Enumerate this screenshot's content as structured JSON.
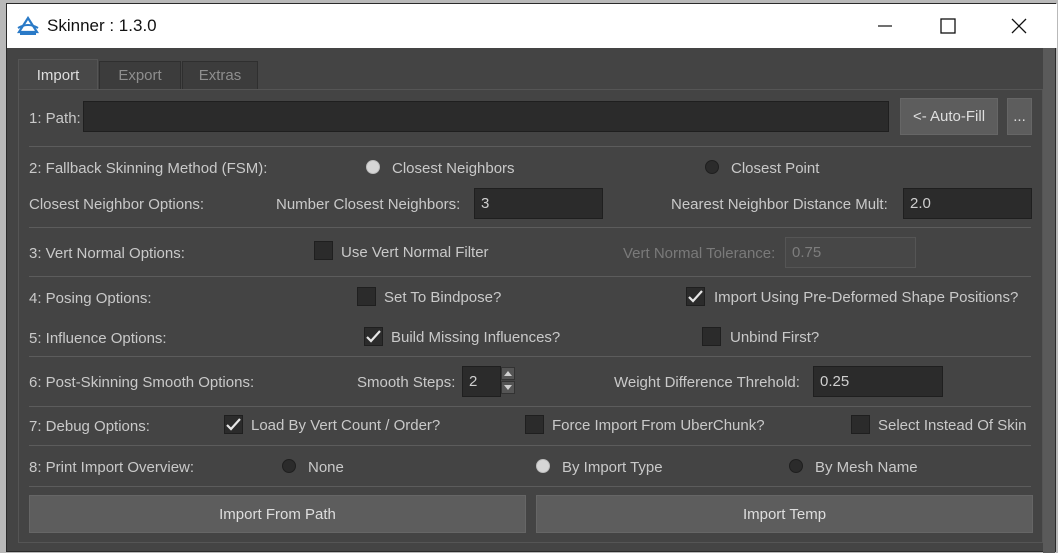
{
  "window": {
    "title": "Skinner : 1.3.0"
  },
  "tabs": [
    {
      "label": "Import"
    },
    {
      "label": "Export"
    },
    {
      "label": "Extras"
    }
  ],
  "path": {
    "label": "1: Path:",
    "value": "",
    "autofill_label": "<- Auto-Fill",
    "browse_label": "..."
  },
  "fsm": {
    "label": "2: Fallback Skinning Method (FSM):",
    "option1": "Closest Neighbors",
    "option2": "Closest Point",
    "selected": "Closest Neighbors"
  },
  "neighbor": {
    "label": "Closest Neighbor Options:",
    "count_label": "Number Closest Neighbors:",
    "count_value": "3",
    "dist_label": "Nearest Neighbor Distance Mult:",
    "dist_value": "2.0"
  },
  "vertnormal": {
    "label": "3: Vert Normal Options:",
    "filter_label": "Use Vert Normal Filter",
    "filter_checked": false,
    "tolerance_label": "Vert Normal Tolerance:",
    "tolerance_value": "0.75"
  },
  "posing": {
    "label": "4: Posing Options:",
    "bindpose_label": "Set To Bindpose?",
    "bindpose_checked": false,
    "predeformed_label": "Import Using Pre-Deformed Shape Positions?",
    "predeformed_checked": true
  },
  "influence": {
    "label": "5: Influence Options:",
    "build_label": "Build Missing Influences?",
    "build_checked": true,
    "unbind_label": "Unbind First?",
    "unbind_checked": false
  },
  "smooth": {
    "label": "6: Post-Skinning Smooth Options:",
    "steps_label": "Smooth Steps:",
    "steps_value": "2",
    "weight_label": "Weight Difference Threhold:",
    "weight_value": "0.25"
  },
  "debug": {
    "label": "7: Debug Options:",
    "vertcount_label": "Load By Vert Count / Order?",
    "vertcount_checked": true,
    "uberchunk_label": "Force Import From UberChunk?",
    "uberchunk_checked": false,
    "select_label": "Select Instead Of Skin",
    "select_checked": false
  },
  "overview": {
    "label": "8: Print Import Overview:",
    "option1": "None",
    "option2": "By Import Type",
    "option3": "By Mesh Name",
    "selected": "By Import Type"
  },
  "actions": {
    "import_path_label": "Import From Path",
    "import_temp_label": "Import Temp"
  },
  "colors": {
    "window_bg": "#444444",
    "field_bg": "#2b2b2b",
    "button_bg": "#5d5d5d",
    "title_bg": "#ffffff"
  }
}
